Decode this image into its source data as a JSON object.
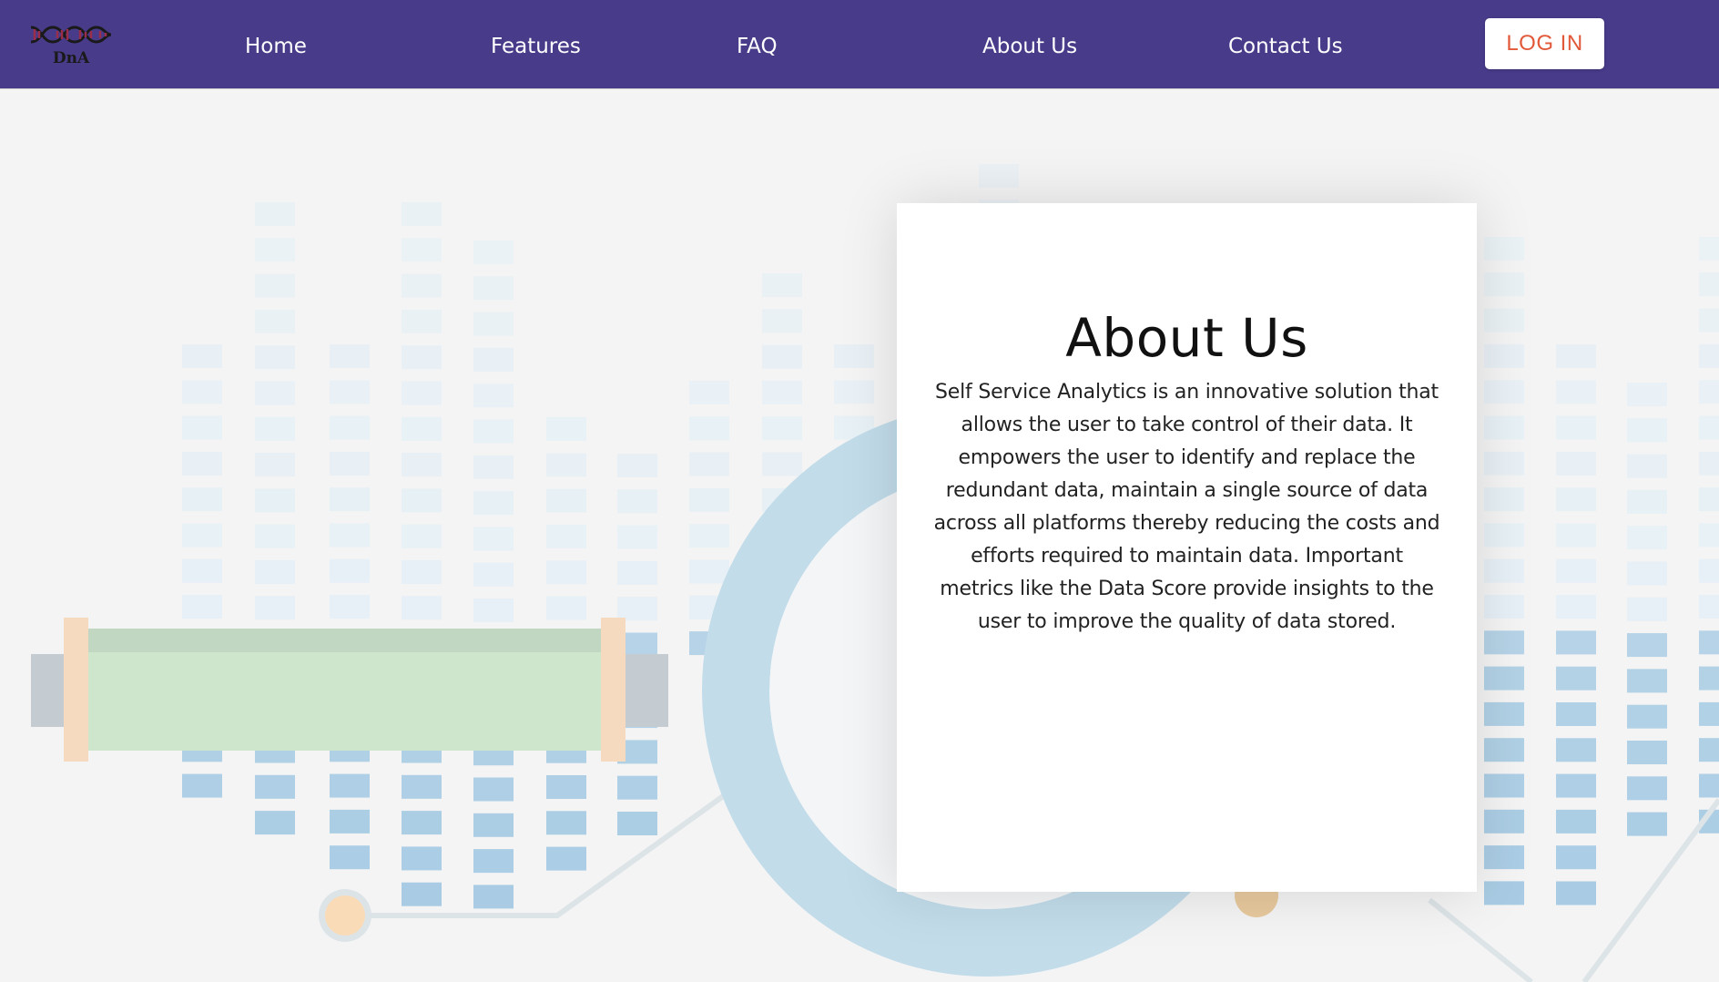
{
  "brand": {
    "logo_text": "DnA"
  },
  "nav": {
    "items": [
      {
        "label": "Home"
      },
      {
        "label": "Features"
      },
      {
        "label": "FAQ"
      },
      {
        "label": "About Us"
      },
      {
        "label": "Contact Us"
      }
    ],
    "login_label": "LOG IN"
  },
  "about": {
    "title": "About Us",
    "body": "Self Service Analytics is an innovative solution that allows the user to take control of their data. It empowers the user to identify and replace the redundant data, maintain a single source of data across all platforms thereby reducing the costs and efforts required to maintain data. Important metrics like the Data Score provide insights to the user to improve the quality of data stored."
  },
  "colors": {
    "navbar": "#483b8a",
    "login_text": "#e2593a",
    "page_background": "#f4f4f4",
    "block_light": "#e3eff6",
    "block_dark": "#a9cce4",
    "ring": "#c2dcea",
    "tube_green": "#cde6cc",
    "tube_cap": "#f6dac0"
  },
  "icons": {
    "logo": "dna-helix-icon"
  }
}
